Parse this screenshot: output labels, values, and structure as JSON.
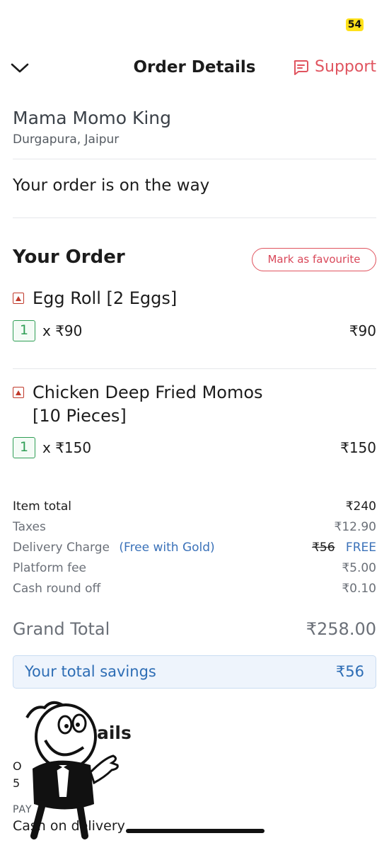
{
  "status_bar": {
    "battery": "54",
    "battery_color": "#ffe11a"
  },
  "header": {
    "title": "Order Details",
    "support_label": "Support",
    "accent": "#e0545f"
  },
  "restaurant": {
    "name": "Mama Momo King",
    "location": "Durgapura, Jaipur"
  },
  "order_status": "Your order is on the way",
  "order": {
    "title": "Your Order",
    "favourite_label": "Mark as favourite",
    "items": [
      {
        "name": "Egg Roll [2 Eggs]",
        "qty": "1",
        "unit_price": "x ₹90",
        "total": "₹90"
      },
      {
        "name_line1": "Chicken Deep Fried Momos",
        "name_line2": "[10 Pieces]",
        "qty": "1",
        "unit_price": "x ₹150",
        "total": "₹150"
      }
    ]
  },
  "bill": {
    "item_total_label": "Item total",
    "item_total": "₹240",
    "taxes_label": "Taxes",
    "taxes": "₹12.90",
    "delivery_label": "Delivery Charge",
    "delivery_note": "(Free with Gold)",
    "delivery_original": "₹56",
    "delivery_value": "FREE",
    "platform_label": "Platform fee",
    "platform": "₹5.00",
    "roundoff_label": "Cash round off",
    "roundoff": "₹0.10",
    "grand_total_label": "Grand Total",
    "grand_total": "₹258.00",
    "savings_label": "Your total savings",
    "savings": "₹56"
  },
  "order_details": {
    "title_fragment": "tails",
    "line1_fragment": "O",
    "line2_fragment": "5",
    "payment_label": "PAY",
    "payment_value": "Cash on delivery"
  }
}
